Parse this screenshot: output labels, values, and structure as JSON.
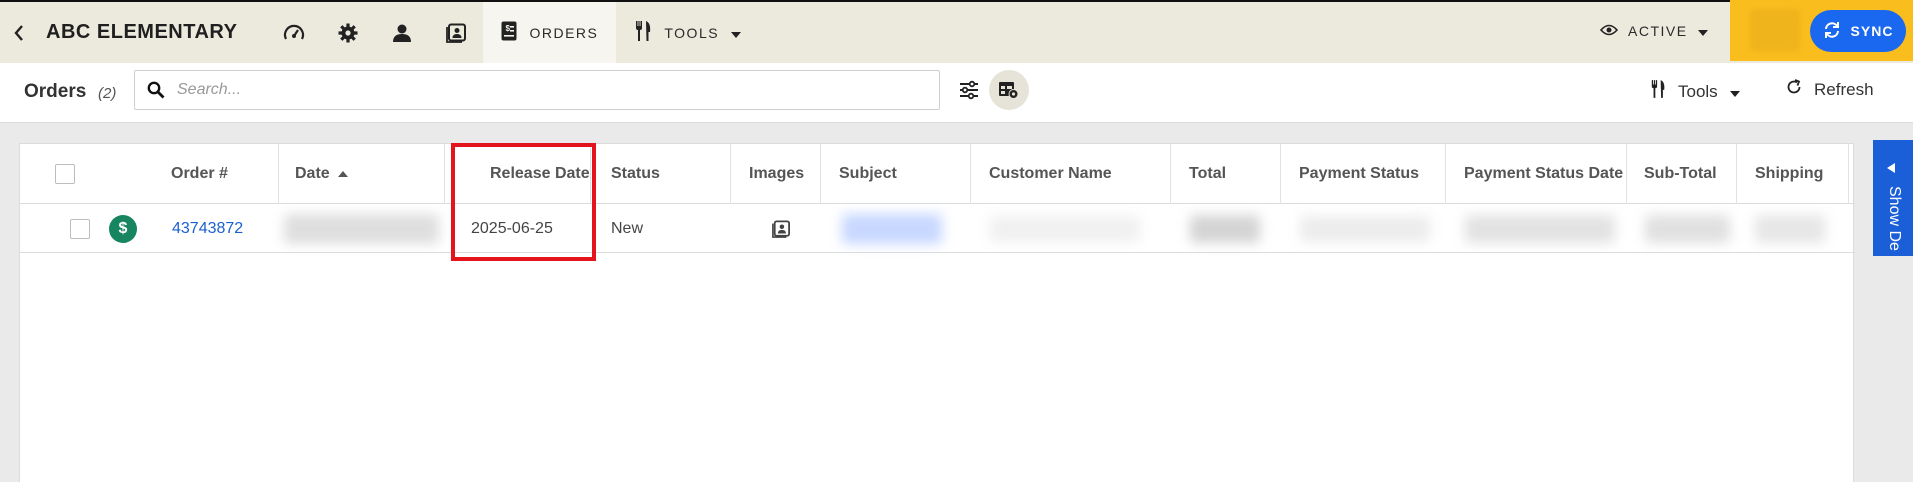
{
  "nav": {
    "school_name": "ABC ELEMENTARY",
    "orders_tab": "ORDERS",
    "tools_tab": "TOOLS",
    "status": "ACTIVE",
    "sync": "SYNC"
  },
  "toolbar": {
    "title": "Orders",
    "count": "(2)",
    "search_placeholder": "Search...",
    "tools": "Tools",
    "refresh": "Refresh"
  },
  "table": {
    "headers": [
      "Order #",
      "Date",
      "Release Date",
      "Status",
      "Images",
      "Subject",
      "Customer Name",
      "Total",
      "Payment Status",
      "Payment Status Date",
      "Sub-Total",
      "Shipping"
    ],
    "rows": [
      {
        "order_number": "43743872",
        "release_date": "2025-06-25",
        "status": "New"
      }
    ]
  },
  "side_tab": {
    "label": "Show De"
  },
  "colors": {
    "nav_bg": "#ece9dd",
    "accent_yellow": "#f9be1e",
    "sync_blue": "#1a67f0",
    "link_blue": "#1a5fd0",
    "paid_green": "#17855f",
    "highlight_red": "#e3141c"
  }
}
